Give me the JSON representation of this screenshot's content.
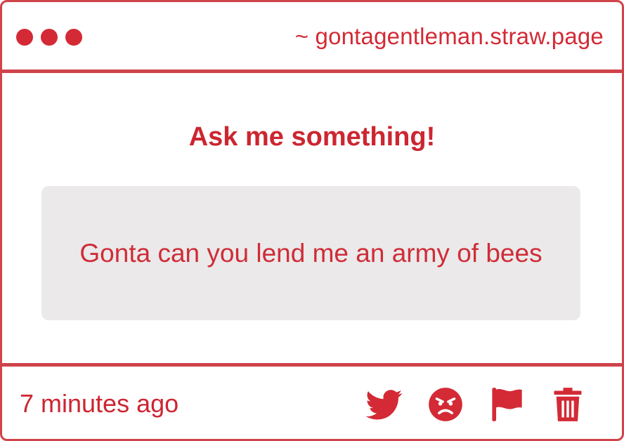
{
  "header": {
    "site_url": "~ gontagentleman.straw.page",
    "window_dots": [
      "dot",
      "dot",
      "dot"
    ]
  },
  "main": {
    "prompt_title": "Ask me something!",
    "question": "Gonta can you lend me an army of bees"
  },
  "footer": {
    "timestamp": "7 minutes ago",
    "actions": [
      {
        "icon": "twitter-icon"
      },
      {
        "icon": "angry-face-icon"
      },
      {
        "icon": "flag-icon"
      },
      {
        "icon": "trash-icon"
      }
    ]
  },
  "colors": {
    "accent": "#d32a35",
    "border": "#d0434a",
    "question_bg": "#ebe9ea",
    "background": "#ffffff"
  }
}
